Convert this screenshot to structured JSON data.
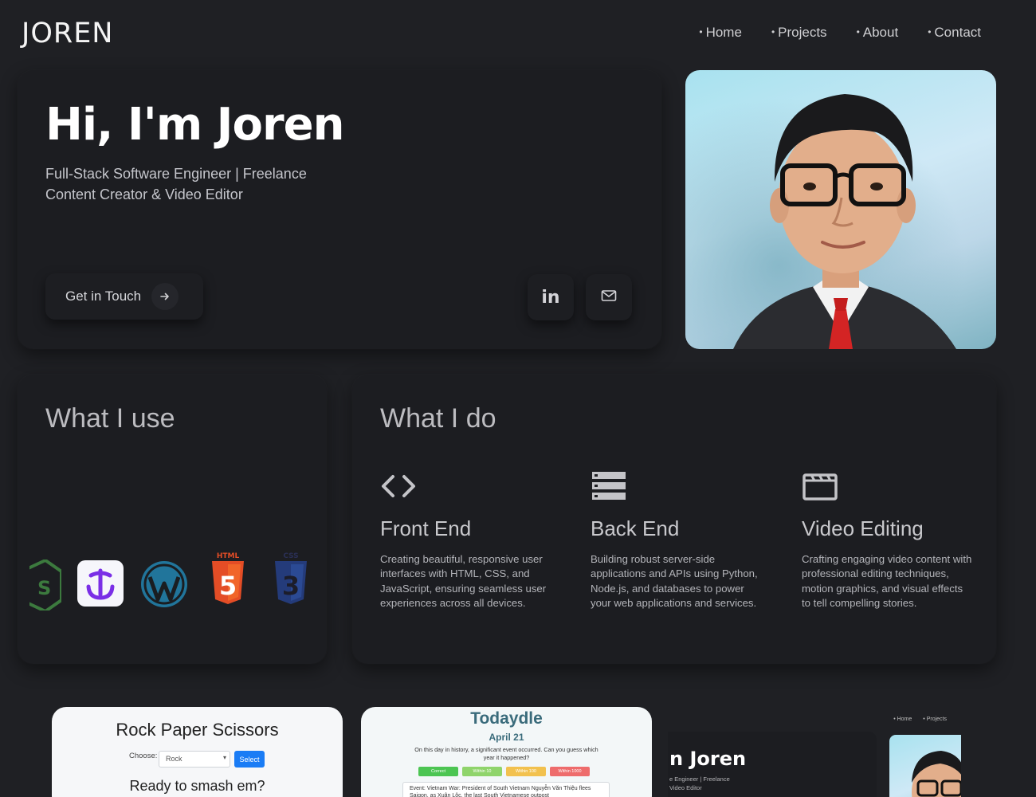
{
  "header": {
    "brand": "JOREN",
    "nav": [
      {
        "label": "Home"
      },
      {
        "label": "Projects"
      },
      {
        "label": "About"
      },
      {
        "label": "Contact"
      }
    ],
    "nav_bullet": "•"
  },
  "hero": {
    "title": "Hi, I'm Joren",
    "subtitle_line1": "Full-Stack Software Engineer | Freelance",
    "subtitle_line2": "Content Creator & Video Editor",
    "cta_label": "Get in Touch",
    "cta_icon": "arrow-right-icon",
    "social": [
      {
        "icon": "linkedin-icon",
        "text": "in"
      },
      {
        "icon": "mail-icon"
      }
    ]
  },
  "portrait": {
    "subject": "profile-photo"
  },
  "tools": {
    "title": "What I use",
    "icons": [
      "nodejs-icon",
      "stripe-like-icon",
      "wordpress-icon",
      "html5-icon",
      "css3-icon"
    ],
    "html5_label": "HTML",
    "html5_glyph": "5",
    "css3_label": "CSS",
    "css3_glyph": "3",
    "nodejs_glyph": "S"
  },
  "services": {
    "title": "What I do",
    "items": [
      {
        "icon": "code-brackets-icon",
        "title": "Front End",
        "description": "Creating beautiful, responsive user interfaces with HTML, CSS, and JavaScript, ensuring seamless user experiences across all devices."
      },
      {
        "icon": "server-stack-icon",
        "title": "Back End",
        "description": "Building robust server-side applications and APIs using Python, Node.js, and databases to power your web applications and services."
      },
      {
        "icon": "clapperboard-icon",
        "title": "Video Editing",
        "description": "Crafting engaging video content with professional editing techniques, motion graphics, and visual effects to tell compelling stories."
      }
    ]
  },
  "projects": {
    "rps": {
      "title": "Rock Paper Scissors",
      "choose_label": "Choose:",
      "select_value": "Rock",
      "button_label": "Select",
      "subtitle": "Ready to smash em?"
    },
    "todaydle": {
      "title": "Todaydle",
      "date": "April 21",
      "intro": "On this day in history, a significant event occurred. Can you guess which year it happened?",
      "legend": [
        {
          "label": "Correct",
          "color": "#4cc552"
        },
        {
          "label": "Within 10",
          "color": "#8fd46b"
        },
        {
          "label": "Within 100",
          "color": "#f2c14e"
        },
        {
          "label": "Within 1000",
          "color": "#ee6c6c"
        }
      ],
      "event": "Event: Vietnam War: President of South Vietnam Nguyễn Văn Thiệu flees Saigon, as Xuân Lộc, the last South Vietnamese outpost"
    },
    "portfolio_preview": {
      "nav": [
        "Home",
        "Projects"
      ],
      "title": "n Joren",
      "sub_line1": "e Engineer | Freelance",
      "sub_line2": "Video Editor"
    }
  }
}
